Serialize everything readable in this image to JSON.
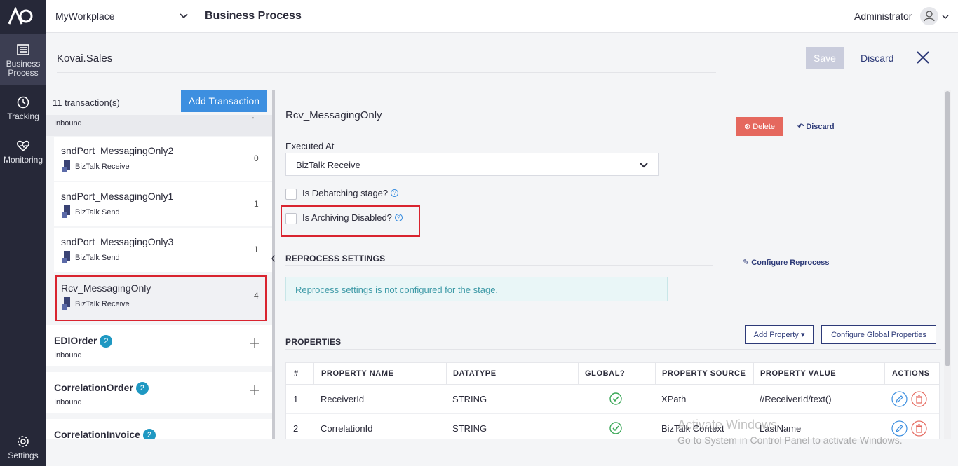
{
  "nav": {
    "items": [
      {
        "label": "Business Process",
        "icon": "list-icon"
      },
      {
        "label": "Tracking",
        "icon": "clock-icon"
      },
      {
        "label": "Monitoring",
        "icon": "heart-icon"
      },
      {
        "label": "Settings",
        "icon": "gear-icon"
      }
    ]
  },
  "topbar": {
    "workplace": "MyWorkplace",
    "page_title": "Business Process",
    "user": "Administrator"
  },
  "header": {
    "process_name": "Kovai.Sales",
    "save_label": "Save",
    "discard_label": "Discard"
  },
  "list": {
    "count_text": "11 transaction(s)",
    "add_label": "Add Transaction",
    "group_top_sub": "Inbound",
    "stages": [
      {
        "name": "sndPort_MessagingOnly2",
        "type": "BizTalk Receive",
        "count": "0"
      },
      {
        "name": "sndPort_MessagingOnly1",
        "type": "BizTalk Send",
        "count": "1"
      },
      {
        "name": "sndPort_MessagingOnly3",
        "type": "BizTalk Send",
        "count": "1"
      },
      {
        "name": "Rcv_MessagingOnly",
        "type": "BizTalk Receive",
        "count": "4"
      }
    ],
    "groups": [
      {
        "name": "EDIOrder",
        "badge": "2",
        "sub": "Inbound"
      },
      {
        "name": "CorrelationOrder",
        "badge": "2",
        "sub": "Inbound"
      },
      {
        "name": "CorrelationInvoice",
        "badge": "2",
        "sub": ""
      }
    ]
  },
  "detail": {
    "stage_name": "Rcv_MessagingOnly",
    "delete_label": "Delete",
    "discard_label": "Discard",
    "executed_at_label": "Executed At",
    "executed_at_value": "BizTalk Receive",
    "debatching_label": "Is Debatching stage?",
    "archiving_label": "Is Archiving Disabled?",
    "reprocess_title": "REPROCESS SETTINGS",
    "configure_reprocess": "Configure Reprocess",
    "reprocess_info": "Reprocess settings is not configured for the stage.",
    "properties_title": "PROPERTIES",
    "add_property": "Add Property",
    "configure_global": "Configure Global Properties"
  },
  "table": {
    "headers": [
      "#",
      "PROPERTY NAME",
      "DATATYPE",
      "GLOBAL?",
      "PROPERTY SOURCE",
      "PROPERTY VALUE",
      "ACTIONS"
    ],
    "rows": [
      {
        "num": "1",
        "name": "ReceiverId",
        "datatype": "STRING",
        "source": "XPath",
        "value": "//ReceiverId/text()"
      },
      {
        "num": "2",
        "name": "CorrelationId",
        "datatype": "STRING",
        "source": "BizTalk Context",
        "value": "LastName"
      }
    ]
  },
  "watermark": {
    "line1": "Activate Windows",
    "line2": "Go to System in Control Panel to activate Windows."
  },
  "colors": {
    "accent": "#3d8fe0",
    "nav_bg": "#262838",
    "danger": "#e5685e",
    "highlight": "#d9242f"
  }
}
